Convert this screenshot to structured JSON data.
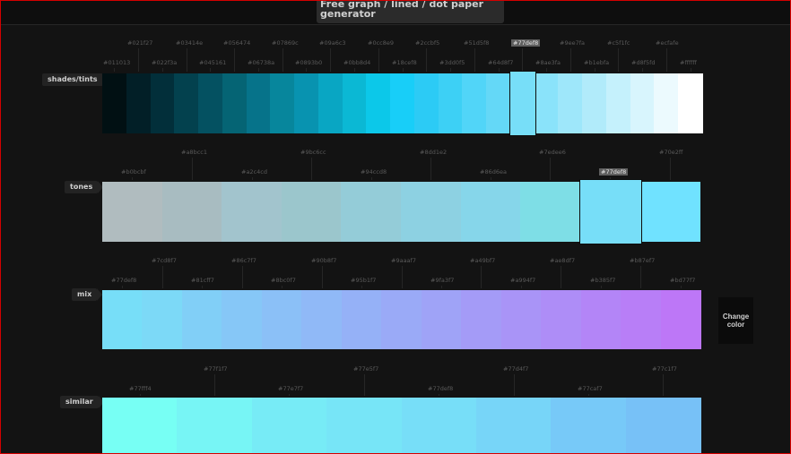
{
  "header": {
    "banner_text": "Free graph / lined / dot paper generator"
  },
  "selected_color": "#77def8",
  "change_color_label": "Change color",
  "rows": [
    {
      "key": "shades",
      "label": "shades/tints",
      "colors": [
        "#011013",
        "#021f27",
        "#022f3a",
        "#03414e",
        "#045161",
        "#056474",
        "#06738a",
        "#07869c",
        "#0893b0",
        "#09a6c3",
        "#0bb8d4",
        "#0cc8e9",
        "#18cef8",
        "#2ccbf5",
        "#3dd0f5",
        "#51d5f8",
        "#64d8f7",
        "#77def8",
        "#8ae3fa",
        "#9ee7fa",
        "#b1ebfa",
        "#c5f1fc",
        "#d8f5fd",
        "#ecfafe",
        "#ffffff"
      ],
      "selected_index": 17
    },
    {
      "key": "tones",
      "label": "tones",
      "colors": [
        "#b0bcbf",
        "#a8bcc1",
        "#a2c4cd",
        "#9bc6cc",
        "#94ccd8",
        "#8dd1e2",
        "#86d6ea",
        "#7edee6",
        "#77def8",
        "#70e2ff"
      ],
      "selected_index": 8
    },
    {
      "key": "mix",
      "label": "mix",
      "colors": [
        "#77def8",
        "#7cd9f7",
        "#81cff7",
        "#86c7f7",
        "#8bc0f7",
        "#90b9f7",
        "#95b1f7",
        "#9aaaf7",
        "#9fa3f7",
        "#a49bf7",
        "#a994f7",
        "#ae8df7",
        "#b385f7",
        "#b87ef7",
        "#bd77f7"
      ],
      "hex_labels": [
        "#77def8",
        "#7cd8f7",
        "#81cff7",
        "#86c7f7",
        "#8bc0f7",
        "#90b8f7",
        "#95b1f7",
        "#9aaaf7",
        "#9fa3f7",
        "#a49bf7",
        "#a994f7",
        "#ae8df7",
        "#b385f7",
        "#b87ef7",
        "#bd77f7"
      ],
      "selected_index": -1
    },
    {
      "key": "similar",
      "label": "similar",
      "colors": [
        "#77fff4",
        "#77f5f5",
        "#77ebf6",
        "#77e5f7",
        "#77def8",
        "#77d5f8",
        "#77c9f8",
        "#77c1f7"
      ],
      "hex_labels": [
        "#77fff4",
        "#77f1f7",
        "#77e7f7",
        "#77e5f7",
        "#77def8",
        "#77d4f7",
        "#77caf7",
        "#77c1f7"
      ],
      "selected_index": -1
    }
  ]
}
